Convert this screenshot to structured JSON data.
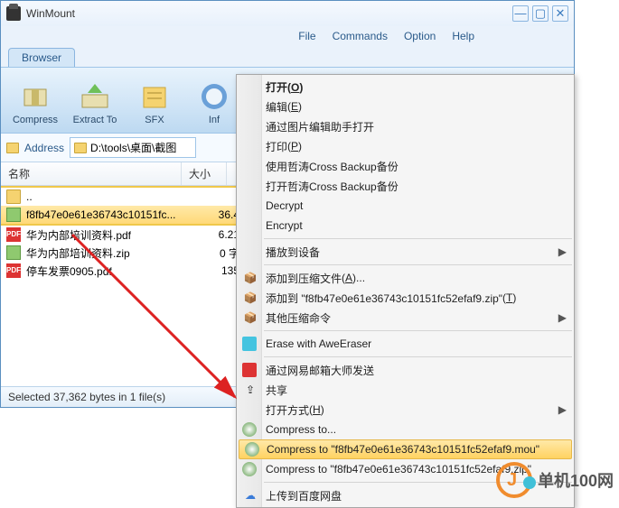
{
  "title": "WinMount",
  "menus": {
    "file": "File",
    "commands": "Commands",
    "option": "Option",
    "help": "Help"
  },
  "tab": "Browser",
  "toolbar": {
    "compress": "Compress",
    "extract": "Extract To",
    "sfx": "SFX",
    "info": "Inf"
  },
  "address": {
    "label": "Address",
    "path": "D:\\tools\\桌面\\截图"
  },
  "columns": {
    "name": "名称",
    "size": "大小"
  },
  "files": [
    {
      "name": "..",
      "size": "",
      "type": "folder"
    },
    {
      "name": "f8fb47e0e61e36743c10151fc...",
      "size": "36.4",
      "type": "zip",
      "selected": true
    },
    {
      "name": "华为内部培训资料.pdf",
      "size": "6.21",
      "type": "pdf"
    },
    {
      "name": "华为内部培训资料.zip",
      "size": "0 字",
      "type": "zip"
    },
    {
      "name": "停车发票0905.pdf",
      "size": "135",
      "type": "pdf"
    }
  ],
  "status": "Selected 37,362 bytes in 1 file(s)",
  "ctx": {
    "open": "打开",
    "open_key": "O",
    "edit": "编辑",
    "edit_key": "E",
    "img_helper": "通过图片编辑助手打开",
    "print": "打印",
    "print_key": "P",
    "cross_use": "使用哲涛Cross Backup备份",
    "cross_open": "打开哲涛Cross Backup备份",
    "decrypt": "Decrypt",
    "encrypt": "Encrypt",
    "play": "播放到设备",
    "add_arc": "添加到压缩文件",
    "add_key": "A",
    "ell": "...",
    "add_to": "添加到 \"f8fb47e0e61e36743c10151fc52efaf9.zip\"",
    "add_to_key": "T",
    "other": "其他压缩命令",
    "erase": "Erase with AweEraser",
    "netease": "通过网易邮箱大师发送",
    "share": "共享",
    "openwith": "打开方式",
    "openwith_key": "H",
    "compress_to": "Compress to...",
    "compress_mou": "Compress to \"f8fb47e0e61e36743c10151fc52efaf9.mou\"",
    "compress_zip": "Compress to \"f8fb47e0e61e36743c10151fc52efaf9.zip\"",
    "baidu": "上传到百度网盘"
  },
  "watermark": "单机100网"
}
